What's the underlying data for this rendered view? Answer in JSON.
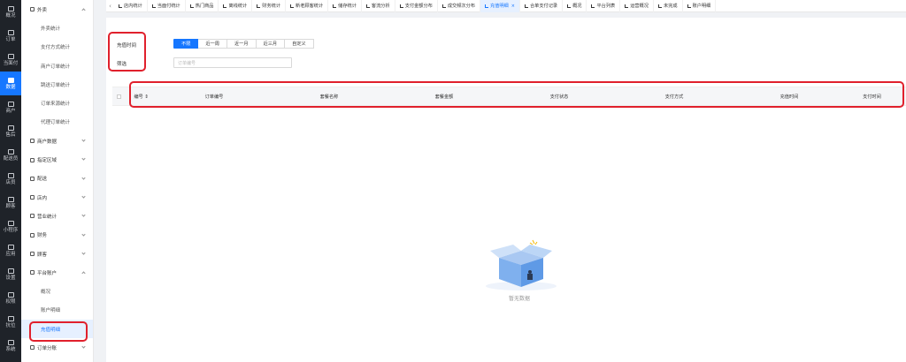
{
  "rail": [
    {
      "label": "概况",
      "icon": "dashboard-icon"
    },
    {
      "label": "订单",
      "icon": "list-icon"
    },
    {
      "label": "当面付",
      "icon": "cash-icon"
    },
    {
      "label": "数据",
      "icon": "bar-chart-icon",
      "active": true
    },
    {
      "label": "商户",
      "icon": "store-icon"
    },
    {
      "label": "售后",
      "icon": "headset-icon"
    },
    {
      "label": "配送员",
      "icon": "courier-icon"
    },
    {
      "label": "店员",
      "icon": "staff-icon"
    },
    {
      "label": "顾客",
      "icon": "customer-icon"
    },
    {
      "label": "小程序",
      "icon": "mini-program-icon"
    },
    {
      "label": "应用",
      "icon": "apps-icon"
    },
    {
      "label": "设置",
      "icon": "settings-icon"
    },
    {
      "label": "权限",
      "icon": "lock-icon"
    },
    {
      "label": "抗位",
      "icon": "doc-icon"
    },
    {
      "label": "系统",
      "icon": "system-icon"
    }
  ],
  "submenu": [
    {
      "label": "外卖",
      "type": "group",
      "open": true,
      "icon": "takeout-icon"
    },
    {
      "label": "外卖统计",
      "type": "child"
    },
    {
      "label": "支付方式统计",
      "type": "child"
    },
    {
      "label": "商户订单统计",
      "type": "child"
    },
    {
      "label": "跳送订单统计",
      "type": "child"
    },
    {
      "label": "订单来源统计",
      "type": "child"
    },
    {
      "label": "代理订单统计",
      "type": "child"
    },
    {
      "label": "商户数据",
      "type": "group",
      "icon": "merchant-data-icon"
    },
    {
      "label": "指定区域",
      "type": "group",
      "icon": "region-icon"
    },
    {
      "label": "配送",
      "type": "group",
      "icon": "delivery-icon"
    },
    {
      "label": "店内",
      "type": "group",
      "icon": "in-store-icon"
    },
    {
      "label": "营业统计",
      "type": "group",
      "icon": "business-stats-icon"
    },
    {
      "label": "财务",
      "type": "group",
      "icon": "finance-icon"
    },
    {
      "label": "顾客",
      "type": "group",
      "icon": "customer-icon"
    },
    {
      "label": "平台账户",
      "type": "group",
      "open": true,
      "icon": "platform-account-icon"
    },
    {
      "label": "概况",
      "type": "child"
    },
    {
      "label": "账户明细",
      "type": "child"
    },
    {
      "label": "充值明细",
      "type": "child",
      "selected": true
    },
    {
      "label": "订单分账",
      "type": "group",
      "icon": "split-icon"
    }
  ],
  "tabs": [
    {
      "label": "店内统计"
    },
    {
      "label": "当面付统计"
    },
    {
      "label": "热门商品"
    },
    {
      "label": "离线统计"
    },
    {
      "label": "财务统计"
    },
    {
      "label": "新老顾客统计"
    },
    {
      "label": "储存统计"
    },
    {
      "label": "客流分析"
    },
    {
      "label": "支付金额分布"
    },
    {
      "label": "成交频次分布"
    },
    {
      "label": "充值明细",
      "active": true
    },
    {
      "label": "合单支付记录"
    },
    {
      "label": "概况"
    },
    {
      "label": "平台列表"
    },
    {
      "label": "运营概况"
    },
    {
      "label": "未完成"
    },
    {
      "label": "账户明细"
    }
  ],
  "filters": {
    "recharge_time_label": "充值时间",
    "screen_label": "筛选",
    "ranges": [
      "不限",
      "近一周",
      "近一月",
      "近三月",
      "自定义"
    ],
    "selected_range": "不限",
    "order_no_placeholder": "订单编号"
  },
  "table": {
    "columns": [
      "编号 ⇕",
      "订单编号",
      "套餐名称",
      "套餐金额",
      "支付状态",
      "支付方式",
      "充值时间",
      "支付时间"
    ]
  },
  "empty": {
    "text": "暂无数据",
    "icon": "empty-box-icon"
  },
  "colors": {
    "accent": "#1677ff",
    "rail": "#1f2329",
    "highlight": "#e0202c"
  }
}
